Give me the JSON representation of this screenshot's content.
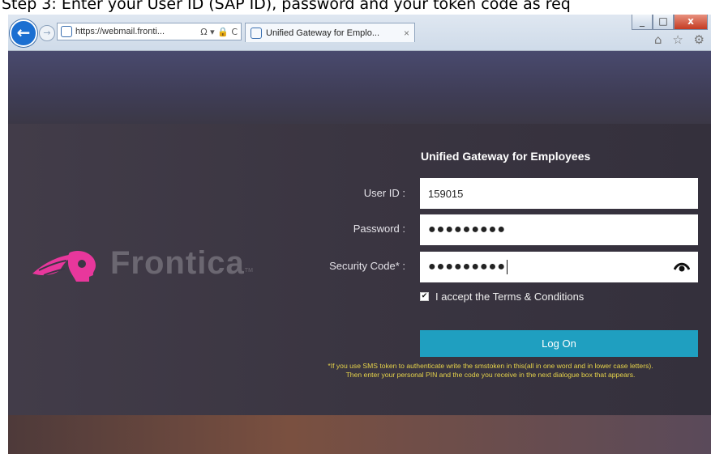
{
  "caption": "Step 3: Enter your User ID (SAP ID), password and your token code as req",
  "window_controls": {
    "minimize": "_",
    "maximize": "□",
    "close": "x"
  },
  "browser": {
    "address_url": "https://webmail.fronti...",
    "address_tools": "Ω ▾ 🔒 C",
    "tab_title": "Unified Gateway for Emplo...",
    "tab_close": "×",
    "right_icons": "⌂ ☆ ⚙"
  },
  "brand": {
    "name": "Frontica",
    "tm": "TM",
    "color": "#e8379c"
  },
  "form": {
    "title": "Unified Gateway for Employees",
    "user_id_label": "User ID :",
    "user_id_value": "159015",
    "password_label": "Password :",
    "password_mask": "●●●●●●●●●",
    "security_label": "Security Code* :",
    "security_mask": "●●●●●●●●●",
    "terms_label": "I accept the Terms & Conditions",
    "terms_checked": true,
    "logon_label": "Log On",
    "note_line1": "*If you use SMS token to authenticate write the smstoken in this(all in one word and in lower case letters).",
    "note_line2": "Then enter your personal PIN and the code you receive in the next dialogue box that appears."
  },
  "colors": {
    "accent": "#1f9fc0",
    "note": "#e6d34a",
    "background": "#3b3645"
  }
}
